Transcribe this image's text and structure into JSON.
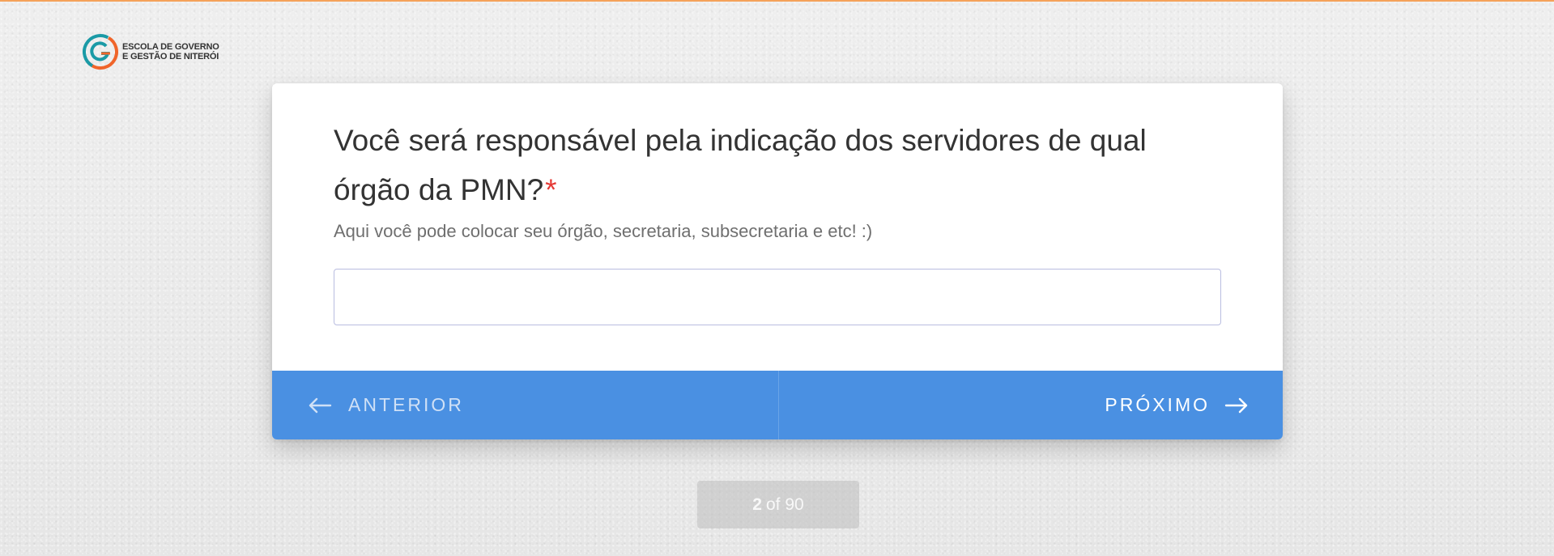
{
  "brand": {
    "name_line1": "ESCOLA DE GOVERNO",
    "name_line2": "E GESTÃO DE NITERÓI",
    "logo_icon": "egg-logo-icon",
    "colors": {
      "teal": "#1a9aa6",
      "orange": "#f0652a",
      "top_bar": "#f5a25a"
    }
  },
  "question": {
    "text": "Você será responsável pela indicação dos servidores de qual órgão da PMN?",
    "required_marker": "*",
    "hint": "Aqui você pode colocar seu órgão, secretaria, subsecretaria e etc!  :)",
    "answer_value": "",
    "answer_placeholder": ""
  },
  "navigation": {
    "prev_label": "ANTERIOR",
    "prev_icon": "arrow-left-icon",
    "next_label": "PRÓXIMO",
    "next_icon": "arrow-right-icon",
    "bar_color": "#4a90e2"
  },
  "pager": {
    "current": "2",
    "total_text": "of 90"
  }
}
